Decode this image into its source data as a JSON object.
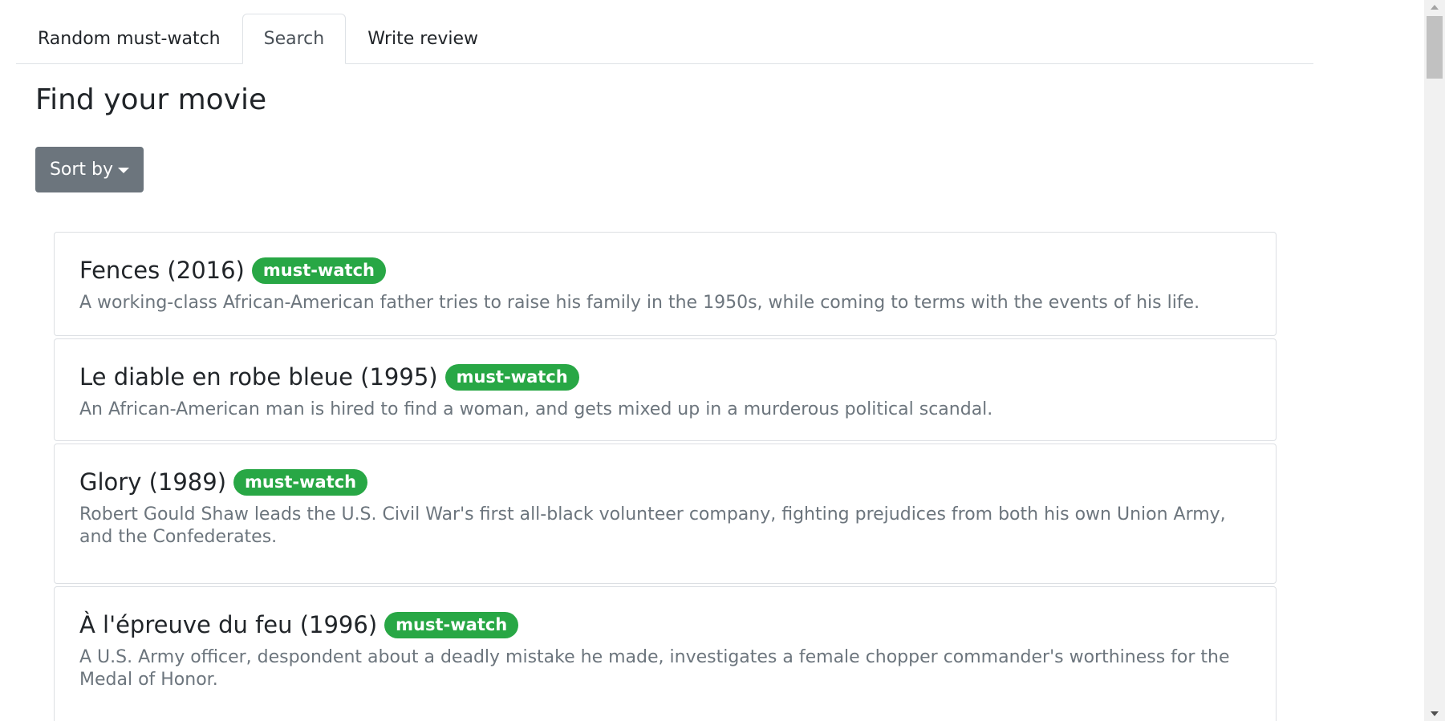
{
  "tabs": [
    {
      "label": "Random must-watch",
      "active": false
    },
    {
      "label": "Search",
      "active": true
    },
    {
      "label": "Write review",
      "active": false
    }
  ],
  "page_title": "Find your movie",
  "sort_button": {
    "label": "Sort by"
  },
  "movies": [
    {
      "title": "Fences (2016)",
      "badge": "must-watch",
      "description": "A working-class African-American father tries to raise his family in the 1950s, while coming to terms with the events of his life."
    },
    {
      "title": "Le diable en robe bleue (1995)",
      "badge": "must-watch",
      "description": "An African-American man is hired to find a woman, and gets mixed up in a murderous political scandal."
    },
    {
      "title": "Glory (1989)",
      "badge": "must-watch",
      "description": "Robert Gould Shaw leads the U.S. Civil War's first all-black volunteer company, fighting prejudices from both his own Union Army, and the Confederates."
    },
    {
      "title": "À l'épreuve du feu (1996)",
      "badge": "must-watch",
      "description": "A U.S. Army officer, despondent about a deadly mistake he made, investigates a female chopper commander's worthiness for the Medal of Honor."
    }
  ],
  "colors": {
    "badge_green": "#28a745",
    "button_gray": "#6c757d",
    "muted_text": "#6c757d"
  }
}
